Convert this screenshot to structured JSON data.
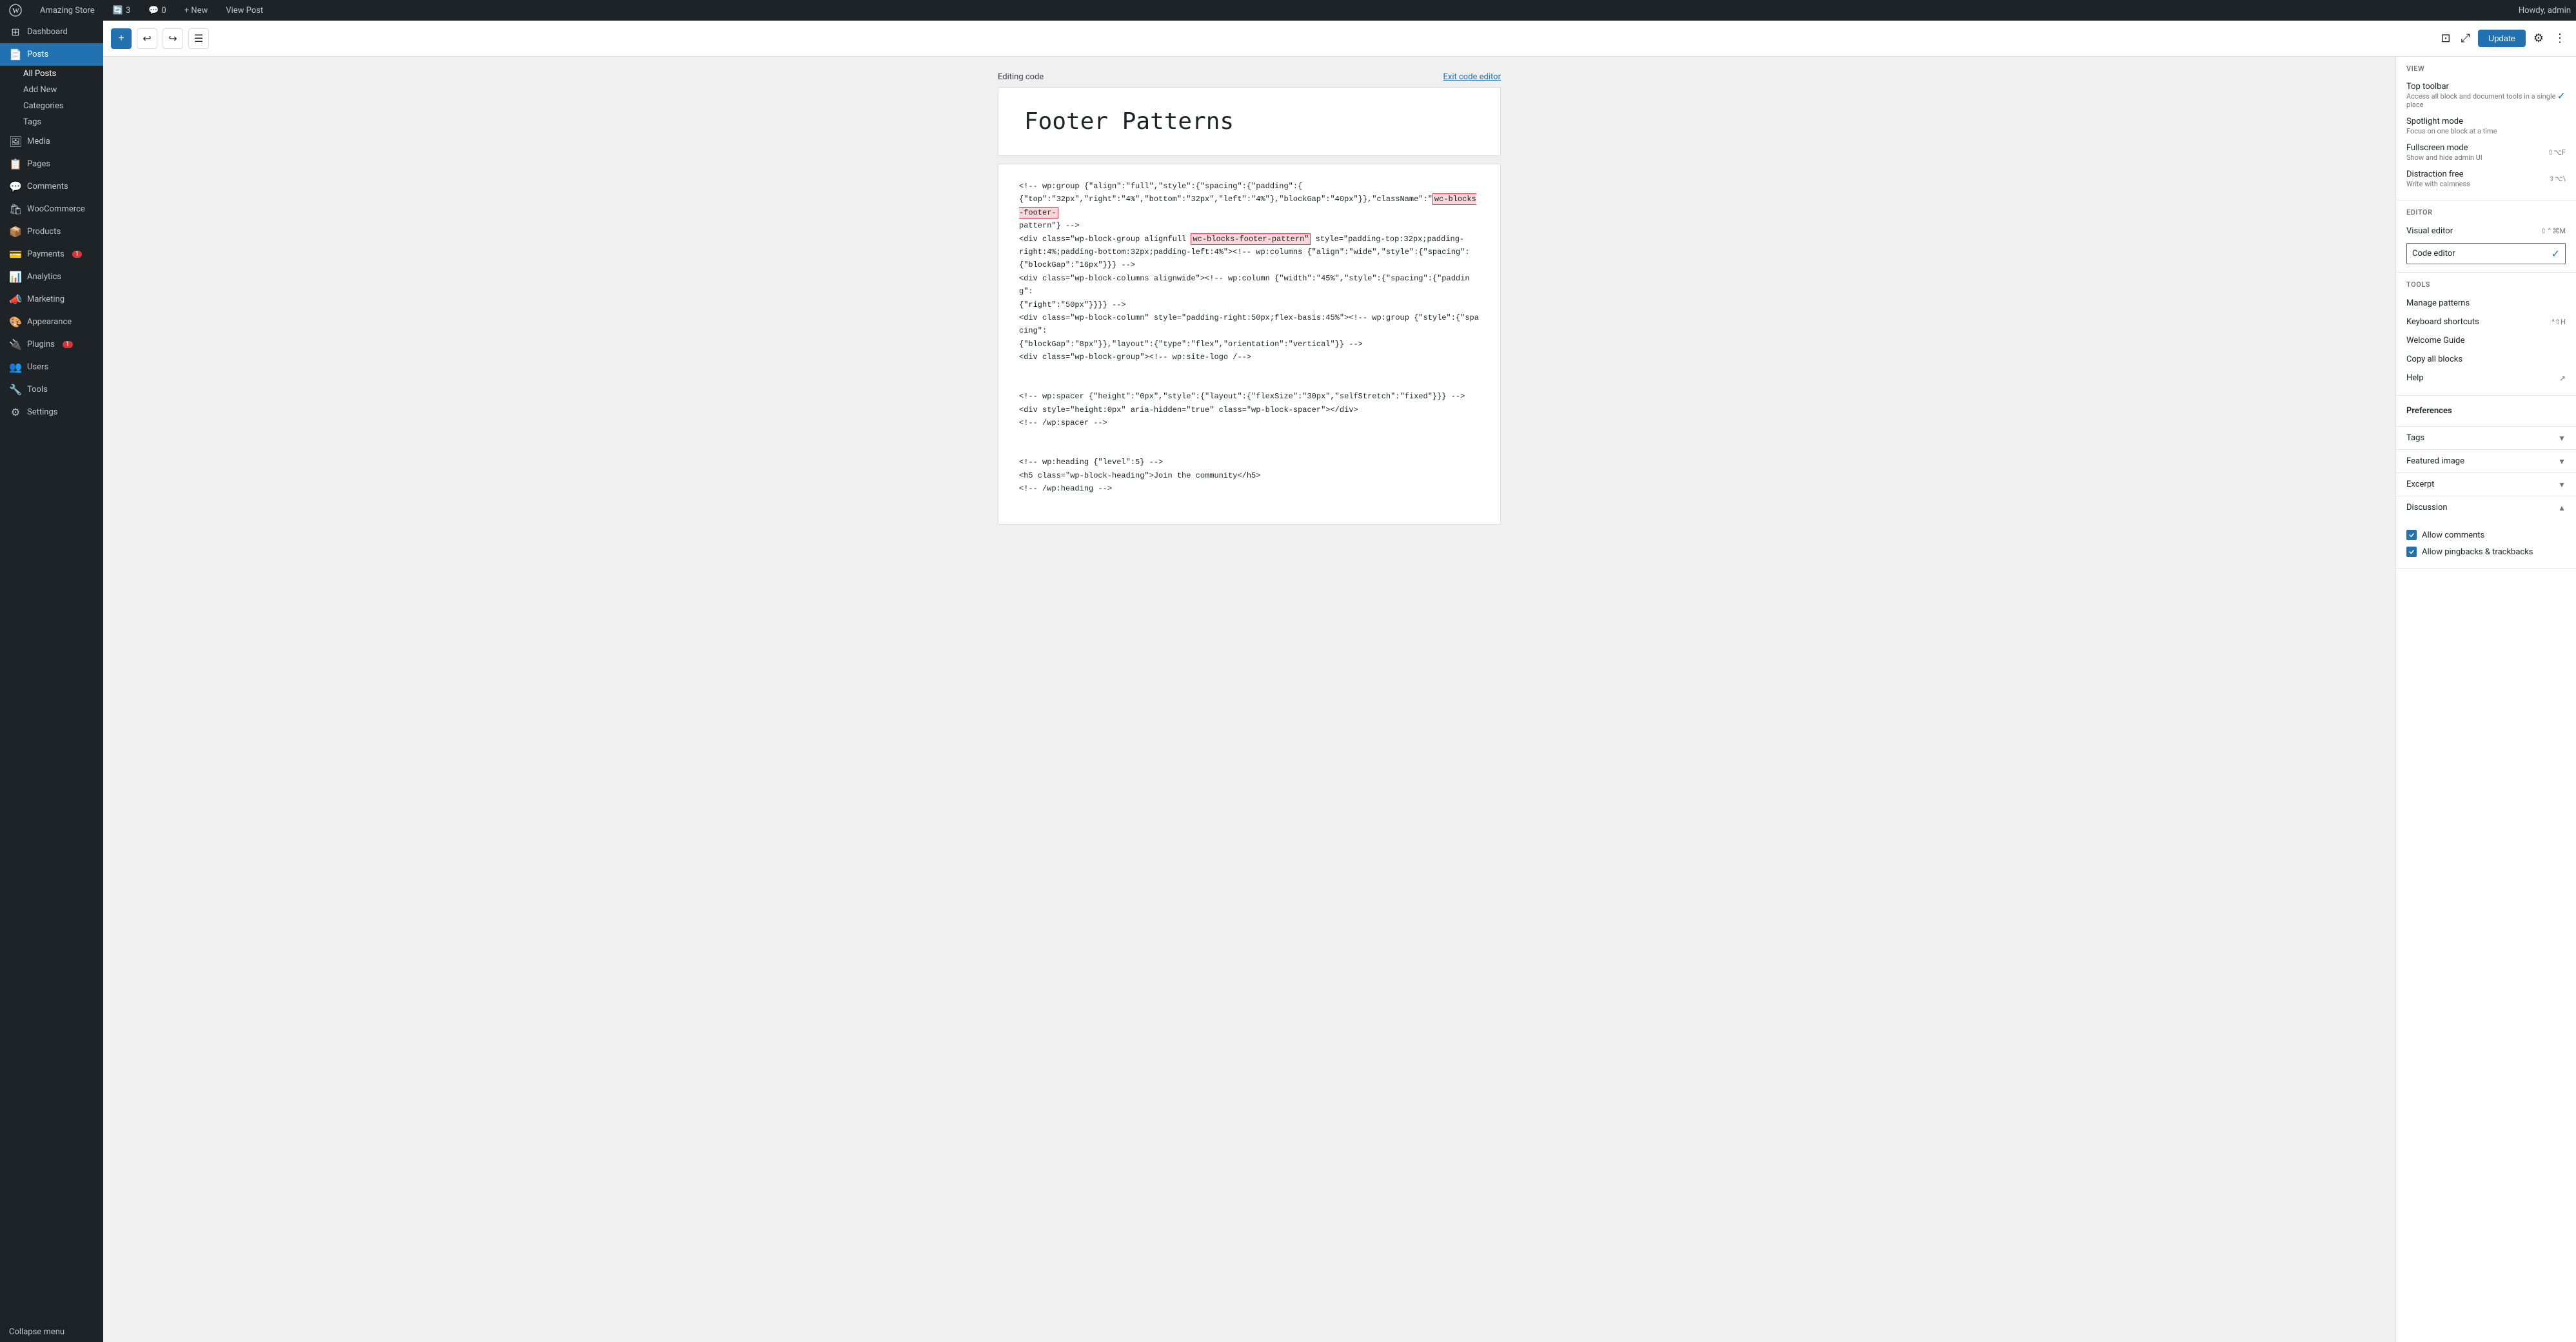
{
  "adminbar": {
    "site_name": "Amazing Store",
    "updates_count": "3",
    "comments_count": "0",
    "new_label": "+ New",
    "view_post": "View Post",
    "howdy": "Howdy, admin"
  },
  "sidebar": {
    "dashboard": "Dashboard",
    "posts": "Posts",
    "posts_sub": [
      "All Posts",
      "Add New",
      "Categories",
      "Tags"
    ],
    "media": "Media",
    "pages": "Pages",
    "comments": "Comments",
    "woocommerce": "WooCommerce",
    "products": "Products",
    "payments": "Payments",
    "payments_badge": "1",
    "analytics": "Analytics",
    "marketing": "Marketing",
    "appearance": "Appearance",
    "plugins": "Plugins",
    "plugins_badge": "1",
    "users": "Users",
    "tools": "Tools",
    "settings": "Settings",
    "collapse": "Collapse menu"
  },
  "toolbar": {
    "add_icon": "+",
    "undo_icon": "↩",
    "redo_icon": "↪",
    "list_icon": "☰",
    "update_label": "Update",
    "view_icon": "⊡",
    "share_icon": "⤢",
    "settings_icon": "⚙",
    "more_icon": "⋮"
  },
  "editing_code_bar": {
    "label": "Editing code",
    "exit_link": "Exit code editor"
  },
  "title_block": {
    "title": "Footer Patterns"
  },
  "code_editor": {
    "lines": [
      "<!-- wp:group {\"align\":\"full\",\"style\":{\"spacing\":{\"padding\":",
      "{\"top\":\"32px\",\"right\":\"4%\",\"bottom\":\"32px\",\"left\":\"4%\"},\"blockGap\":\"40px\"}},\"className\":\"wc-blocks-footer-",
      "pattern\"} -->",
      "<div class=\"wp-block-group alignfull wc-blocks-footer-pattern\" style=\"padding-top:32px;padding-",
      "right:4%;padding-bottom:32px;padding-left:4%\"><!-- wp:columns {\"align\":\"wide\",\"style\":{\"spacing\":",
      "{\"blockGap\":\"16px\"}}} -->",
      "<div class=\"wp-block-columns alignwide\"><!-- wp:column {\"width\":\"45%\",\"style\":{\"spacing\":{\"padding\":",
      "{\"right\":\"50px\"}}}} -->",
      "<div class=\"wp-block-column\" style=\"padding-right:50px;flex-basis:45%\"><!-- wp:group {\"style\":{\"spacing\":",
      "{\"blockGap\":\"8px\"}},\"layout\":{\"type\":\"flex\",\"orientation\":\"vertical\"}} -->",
      "<div class=\"wp-block-group\"><!-- wp:site-logo /-->",
      "",
      "<!-- wp:spacer {\"height\":\"0px\",\"style\":{\"layout\":{\"flexSize\":\"30px\",\"selfStretch\":\"fixed\"}}} -->",
      "<div style=\"height:0px\" aria-hidden=\"true\" class=\"wp-block-spacer\"></div>",
      "<!-- /wp:spacer -->",
      "",
      "<!-- wp:heading {\"level\":5} -->",
      "<h5 class=\"wp-block-heading\">Join the community</h5>",
      "<!-- /wp:heading -->"
    ],
    "highlight1_start": "{\"top\":\"32px\",\"right\":\"4%\",\"bottom\":\"32px\",\"left\":\"4%\"},\"blockGap\":\"40px\"}},\"className\":\"",
    "highlight1_text": "wc-blocks-footer-",
    "highlight2_text": "wc-blocks-footer-pattern\""
  },
  "right_panel": {
    "view_section_label": "VIEW",
    "top_toolbar_label": "Top toolbar",
    "top_toolbar_subtitle": "Access all block and document tools in a single place",
    "top_toolbar_checked": true,
    "spotlight_label": "Spotlight mode",
    "spotlight_subtitle": "Focus on one block at a time",
    "fullscreen_label": "Fullscreen mode",
    "fullscreen_subtitle": "Show and hide admin UI",
    "fullscreen_shortcut": "⇧⌥F",
    "distraction_label": "Distraction free",
    "distraction_subtitle": "Write with calmness",
    "distraction_shortcut": "⇧⌥\\",
    "editor_section_label": "EDITOR",
    "visual_editor_label": "Visual editor",
    "visual_editor_shortcut": "⇧⌃⌘M",
    "code_editor_label": "Code editor",
    "code_editor_shortcut": "",
    "code_editor_active": true,
    "tools_section_label": "TOOLS",
    "manage_patterns": "Manage patterns",
    "keyboard_shortcuts": "Keyboard shortcuts",
    "keyboard_shortcut": "^⇧H",
    "welcome_guide": "Welcome Guide",
    "copy_all_blocks": "Copy all blocks",
    "help": "Help",
    "preferences_label": "Preferences",
    "tags_label": "Tags",
    "featured_image_label": "Featured image",
    "excerpt_label": "Excerpt",
    "discussion_label": "Discussion",
    "allow_comments_label": "Allow comments",
    "allow_pingbacks_label": "Allow pingbacks & trackbacks"
  }
}
